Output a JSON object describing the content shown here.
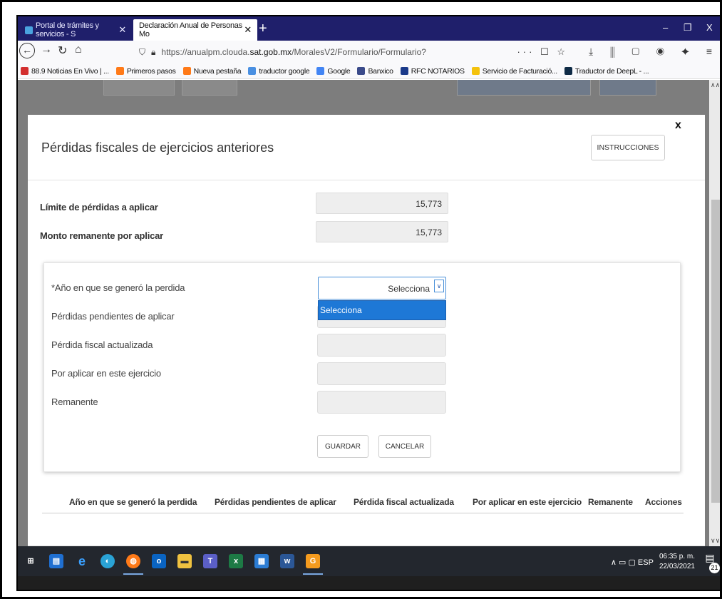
{
  "browser": {
    "tabs": [
      {
        "title": "Portal de trámites y servicios - S",
        "active": false,
        "favicon_color": "#4aa3df"
      },
      {
        "title": "Declaración Anual de Personas Mo",
        "active": true,
        "favicon_color": ""
      }
    ],
    "new_tab": "+",
    "window_controls": {
      "minimize": "–",
      "restore": "❐",
      "close": "X"
    },
    "url": {
      "prefix": "https://anualpm.clouda.",
      "domain": "sat.gob.mx",
      "path": "/MoralesV2/Formulario/Formulario?"
    },
    "url_actions": "··· ☐ ☆",
    "toolbar_icons": "⤓ ⫼ ▢ ◉ ✦ ≡",
    "bookmarks": [
      {
        "label": "88.9 Noticias En Vivo | ...",
        "color": "#d32f2f"
      },
      {
        "label": "Primeros pasos",
        "color": "#ff7a18"
      },
      {
        "label": "Nueva pestaña",
        "color": "#ff7a18"
      },
      {
        "label": "traductor google",
        "color": "#4a90e2"
      },
      {
        "label": "Google",
        "color": "#4285f4"
      },
      {
        "label": "Banxico",
        "color": "#3a4a8a"
      },
      {
        "label": "RFC NOTARIOS",
        "color": "#1a3a8a"
      },
      {
        "label": "Servicio de Facturació...",
        "color": "#f4c20d"
      },
      {
        "label": "Traductor de DeepL - ...",
        "color": "#0f2b46"
      }
    ]
  },
  "modal": {
    "title": "Pérdidas fiscales de ejercicios anteriores",
    "close": "x",
    "instructions_button": "INSTRUCCIONES",
    "limit_label": "Límite de pérdidas a aplicar",
    "limit_value": "15,773",
    "remaining_label": "Monto remanente por aplicar",
    "remaining_value": "15,773",
    "form": {
      "year_label": "*Año en que se generó la perdida",
      "year_select_value": "Selecciona",
      "year_options": [
        "Selecciona"
      ],
      "pending_label": "Pérdidas pendientes de aplicar",
      "updated_label": "Pérdida fiscal actualizada",
      "apply_label": "Por aplicar en este ejercicio",
      "remnant_label": "Remanente",
      "save_button": "GUARDAR",
      "cancel_button": "CANCELAR"
    },
    "table_headers": [
      "Año en que se generó la perdida",
      "Pérdidas pendientes de aplicar",
      "Pérdida fiscal actualizada",
      "Por aplicar en este ejercicio",
      "Remanente",
      "Acciones"
    ]
  },
  "taskbar": {
    "tray": "∧ ▭ ▢ ESP",
    "time": "06:35 p. m.",
    "date": "22/03/2021",
    "notifications": "21"
  }
}
